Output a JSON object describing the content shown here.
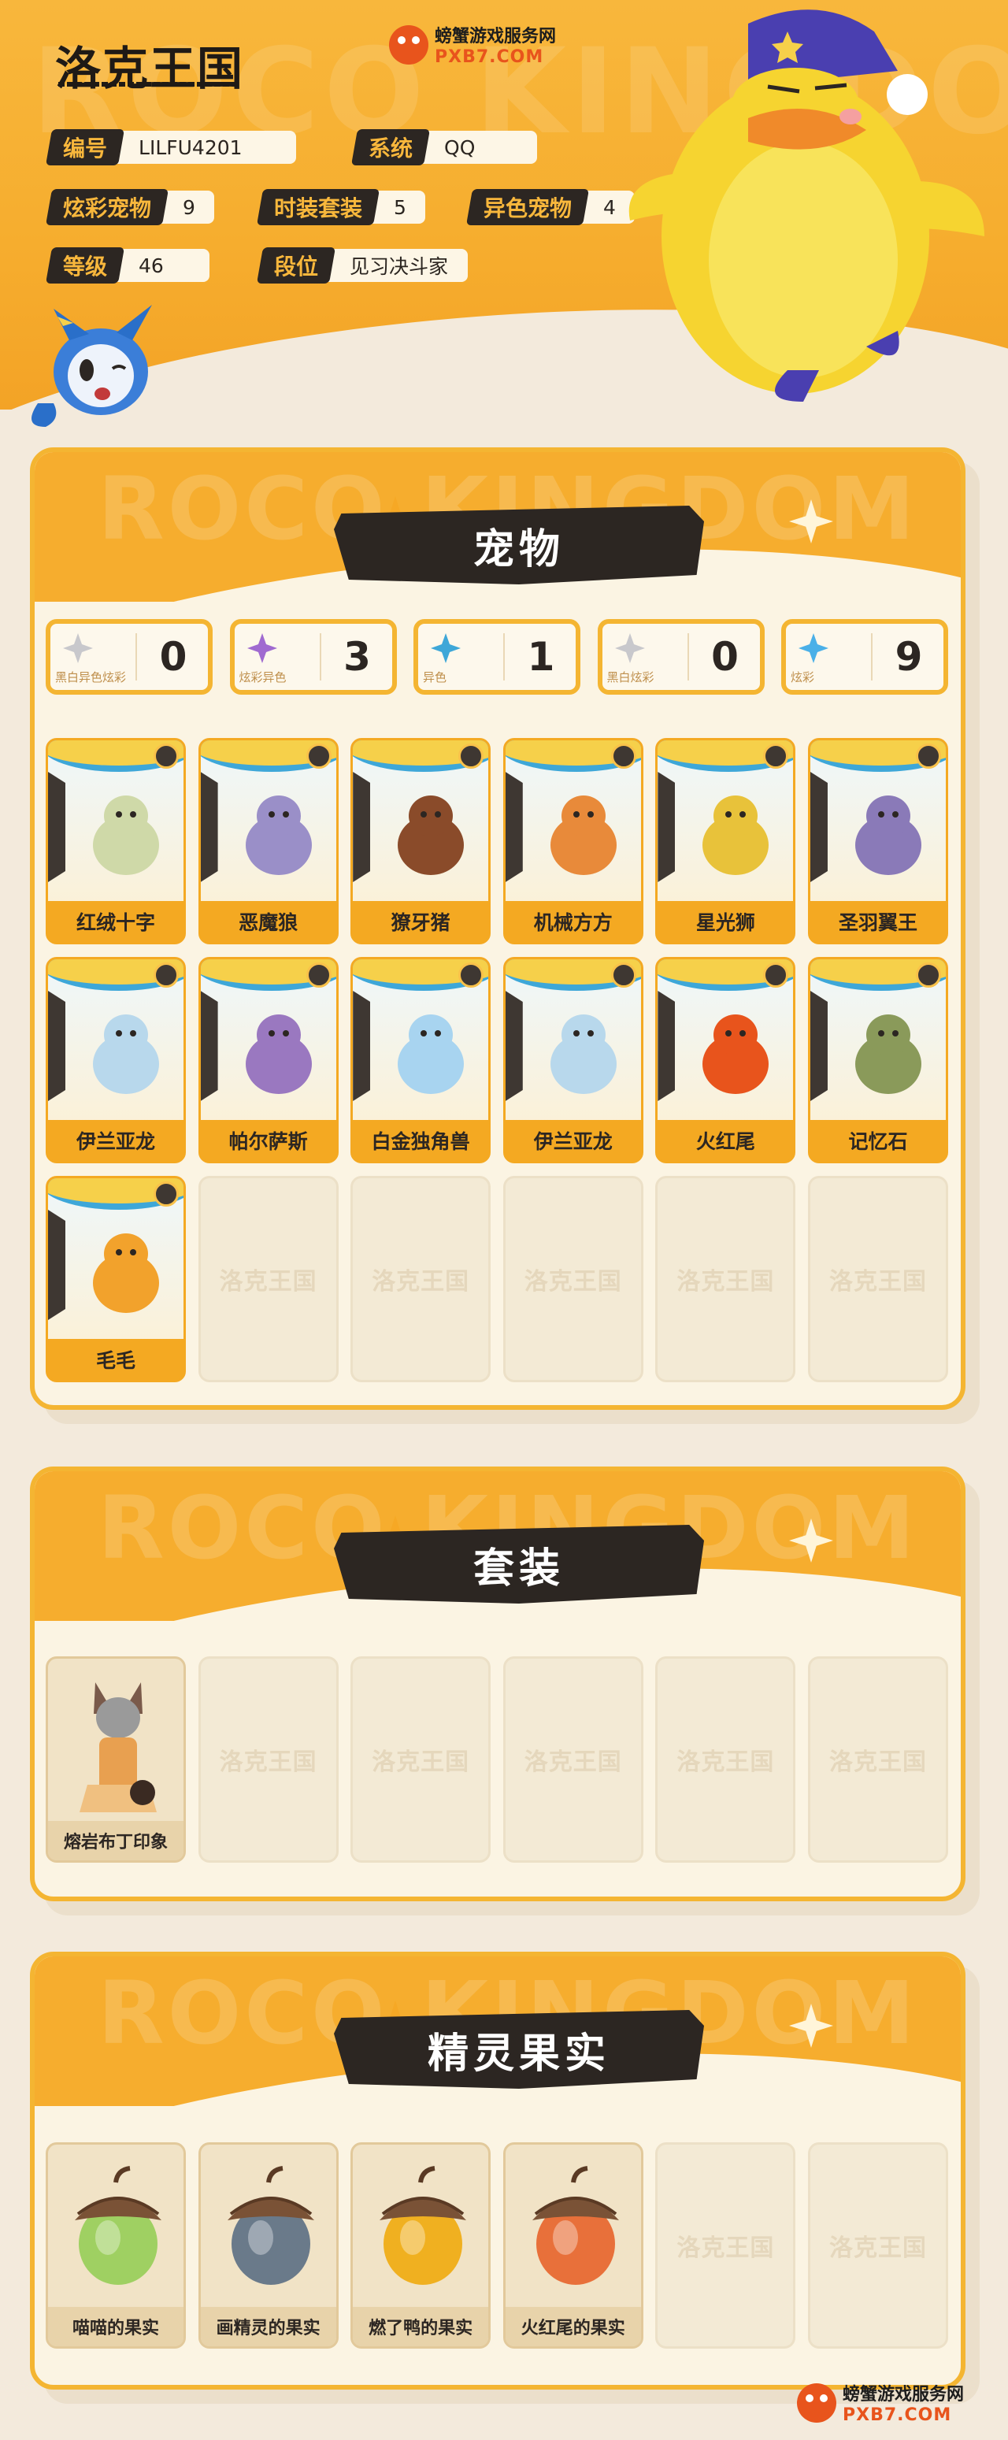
{
  "brand": {
    "logo": "洛克王国",
    "watermark": "ROCO KINGDOM"
  },
  "site": {
    "cn": "螃蟹游戏服务网",
    "en": "PXB7.COM"
  },
  "profile": {
    "id_label": "编号",
    "id_value": "LILFU4201",
    "system_label": "系统",
    "system_value": "QQ",
    "flash_label": "炫彩宠物",
    "flash_value": "9",
    "fashion_label": "时装套装",
    "fashion_value": "5",
    "variant_label": "异色宠物",
    "variant_value": "4",
    "level_label": "等级",
    "level_value": "46",
    "rank_label": "段位",
    "rank_value": "见习决斗家"
  },
  "pets_section": {
    "title": "宠物",
    "stats": [
      {
        "label": "黑白异色炫彩",
        "value": "0",
        "icon": "bw-variant-flash-icon"
      },
      {
        "label": "炫彩异色",
        "value": "3",
        "icon": "flash-variant-icon"
      },
      {
        "label": "异色",
        "value": "1",
        "icon": "variant-icon"
      },
      {
        "label": "黑白炫彩",
        "value": "0",
        "icon": "bw-flash-icon"
      },
      {
        "label": "炫彩",
        "value": "9",
        "icon": "flash-icon"
      }
    ],
    "pets": [
      {
        "name": "红绒十字",
        "color": "#cfd9a8"
      },
      {
        "name": "恶魔狼",
        "color": "#9a8fc8"
      },
      {
        "name": "獠牙猪",
        "color": "#8a4b2a"
      },
      {
        "name": "机械方方",
        "color": "#e88a3a"
      },
      {
        "name": "星光狮",
        "color": "#e8c23a"
      },
      {
        "name": "圣羽翼王",
        "color": "#8a7ab8"
      },
      {
        "name": "伊兰亚龙",
        "color": "#b8d8ec"
      },
      {
        "name": "帕尔萨斯",
        "color": "#9a78c0"
      },
      {
        "name": "白金独角兽",
        "color": "#a8d4f0"
      },
      {
        "name": "伊兰亚龙",
        "color": "#b8d8ec"
      },
      {
        "name": "火红尾",
        "color": "#e8541c"
      },
      {
        "name": "记忆石",
        "color": "#8a9a5a"
      },
      {
        "name": "毛毛",
        "color": "#f2a22c"
      }
    ],
    "empty_label": "洛克王国",
    "empty_count": 5
  },
  "suits_section": {
    "title": "套装",
    "suits": [
      {
        "name": "熔岩布丁印象"
      }
    ],
    "empty_label": "洛克王国",
    "empty_count": 5
  },
  "fruits_section": {
    "title": "精灵果实",
    "fruits": [
      {
        "name": "喵喵的果实",
        "color": "#9fd062"
      },
      {
        "name": "画精灵的果实",
        "color": "#6a7a8a"
      },
      {
        "name": "燃了鸭的果实",
        "color": "#f0b020"
      },
      {
        "name": "火红尾的果实",
        "color": "#e8703a"
      }
    ],
    "empty_label": "洛克王国",
    "empty_count": 2
  },
  "footer": {
    "cn": "螃蟹游戏服务网",
    "en": "PXB7.COM"
  }
}
